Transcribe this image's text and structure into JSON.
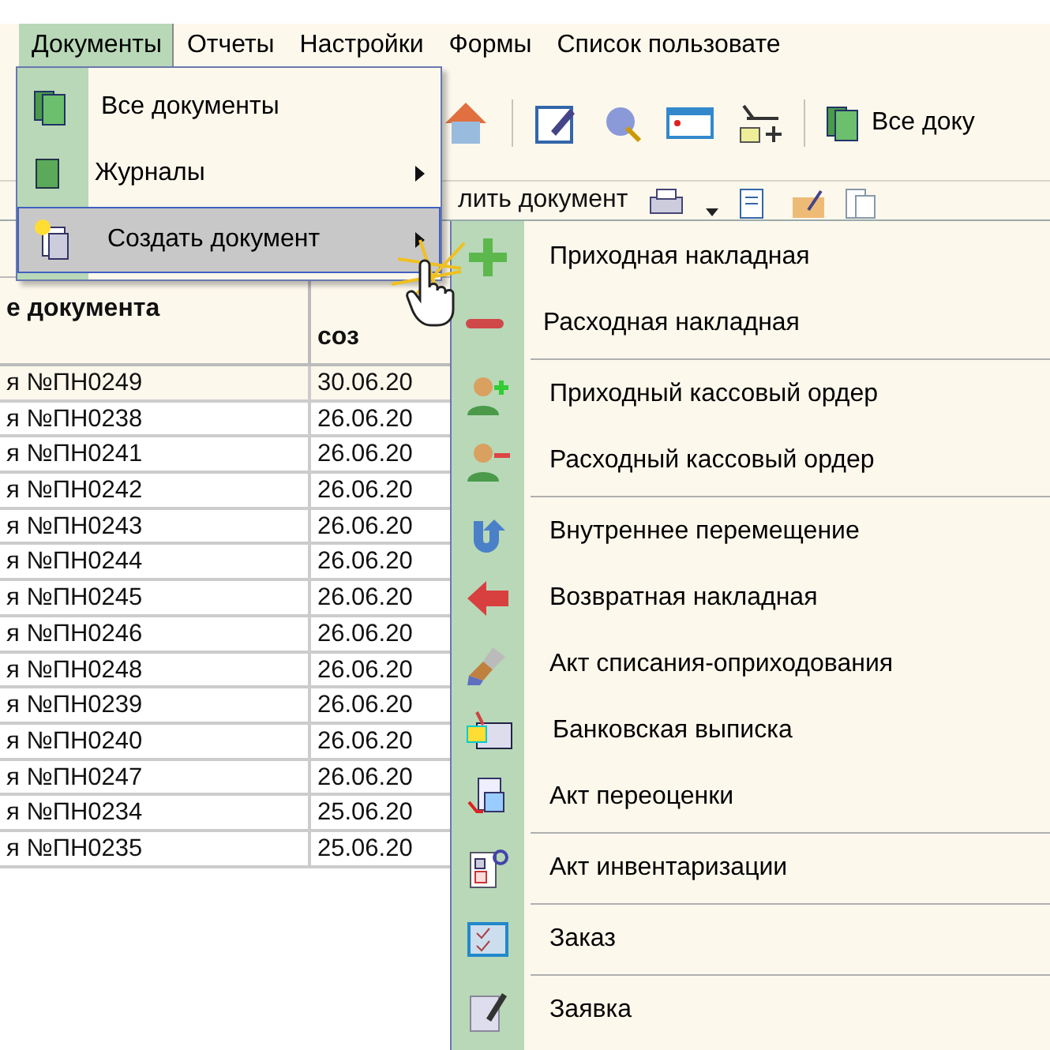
{
  "menubar": [
    {
      "label": "Документы",
      "selected": true
    },
    {
      "label": "Отчеты",
      "selected": false
    },
    {
      "label": "Настройки",
      "selected": false
    },
    {
      "label": "Формы",
      "selected": false
    },
    {
      "label": "Список пользовате",
      "selected": false
    }
  ],
  "toolbar": {
    "button_label": "Все доку",
    "partial_text": "лить документ"
  },
  "documents_menu": [
    {
      "label": "Все документы",
      "submenu": false,
      "selected": false
    },
    {
      "label": "Журналы",
      "submenu": true,
      "selected": false
    },
    {
      "label": "Создать документ",
      "submenu": true,
      "selected": true
    }
  ],
  "create_submenu": [
    {
      "label": "Приходная накладная",
      "separator_before": false
    },
    {
      "label": "Расходная накладная",
      "separator_before": false
    },
    {
      "label": "Приходный кассовый ордер",
      "separator_before": true
    },
    {
      "label": "Расходный кассовый ордер",
      "separator_before": false
    },
    {
      "label": "Внутреннее перемещение",
      "separator_before": true
    },
    {
      "label": "Возвратная накладная",
      "separator_before": false
    },
    {
      "label": "Акт списания-оприходования",
      "separator_before": false
    },
    {
      "label": "Банковская выписка",
      "separator_before": false
    },
    {
      "label": "Акт переоценки",
      "separator_before": false
    },
    {
      "label": "Акт инвентаризации",
      "separator_before": true
    },
    {
      "label": "Заказ",
      "separator_before": true
    },
    {
      "label": "Заявка",
      "separator_before": true
    }
  ],
  "table": {
    "columns": [
      "е документа",
      "соз"
    ],
    "rows": [
      {
        "cells": [
          "я №ПН0249",
          "30.06.20"
        ],
        "selected": true
      },
      {
        "cells": [
          "я №ПН0238",
          "26.06.20"
        ],
        "selected": false
      },
      {
        "cells": [
          "я №ПН0241",
          "26.06.20"
        ],
        "selected": false
      },
      {
        "cells": [
          "я №ПН0242",
          "26.06.20"
        ],
        "selected": false
      },
      {
        "cells": [
          "я №ПН0243",
          "26.06.20"
        ],
        "selected": false
      },
      {
        "cells": [
          "я №ПН0244",
          "26.06.20"
        ],
        "selected": false
      },
      {
        "cells": [
          "я №ПН0245",
          "26.06.20"
        ],
        "selected": false
      },
      {
        "cells": [
          "я №ПН0246",
          "26.06.20"
        ],
        "selected": false
      },
      {
        "cells": [
          "я №ПН0248",
          "26.06.20"
        ],
        "selected": false
      },
      {
        "cells": [
          "я №ПН0239",
          "26.06.20"
        ],
        "selected": false
      },
      {
        "cells": [
          "я №ПН0240",
          "26.06.20"
        ],
        "selected": false
      },
      {
        "cells": [
          "я №ПН0247",
          "26.06.20"
        ],
        "selected": false
      },
      {
        "cells": [
          "я №ПН0234",
          "25.06.20"
        ],
        "selected": false
      },
      {
        "cells": [
          "я №ПН0235",
          "25.06.20"
        ],
        "selected": false
      }
    ]
  }
}
